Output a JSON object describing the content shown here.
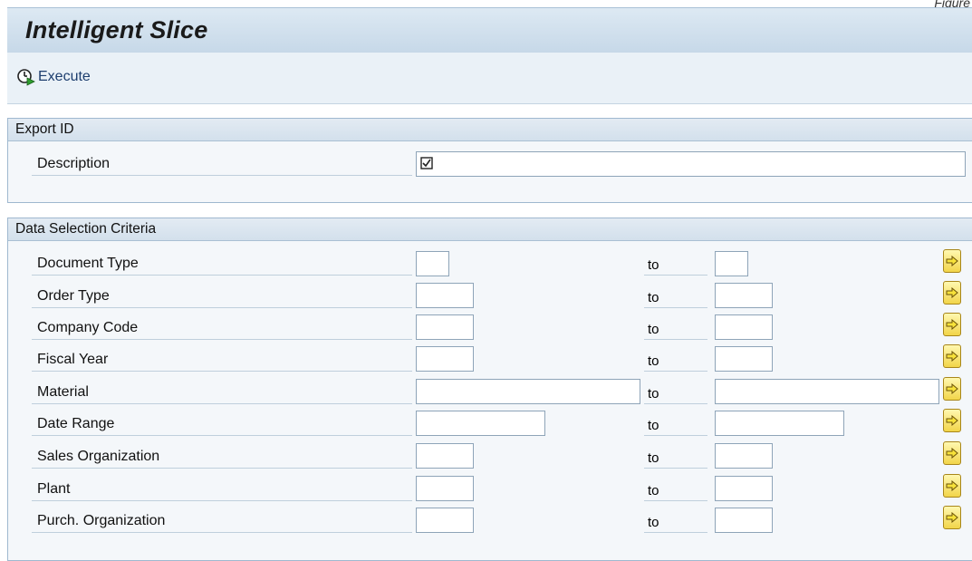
{
  "corner_label": "Figure",
  "title": "Intelligent Slice",
  "toolbar": {
    "execute_label": "Execute",
    "execute_icon": "execute-clock-icon"
  },
  "export_group": {
    "title": "Export ID",
    "row": {
      "label": "Description",
      "checkbox_checked": true,
      "value": ""
    }
  },
  "selection_group": {
    "title": "Data Selection Criteria",
    "to_label": "to",
    "rows": [
      {
        "label": "Document Type",
        "from": "",
        "to": ""
      },
      {
        "label": "Order Type",
        "from": "",
        "to": ""
      },
      {
        "label": "Company Code",
        "from": "",
        "to": ""
      },
      {
        "label": "Fiscal Year",
        "from": "",
        "to": ""
      },
      {
        "label": "Material",
        "from": "",
        "to": ""
      },
      {
        "label": "Date Range",
        "from": "",
        "to": ""
      },
      {
        "label": "Sales Organization",
        "from": "",
        "to": ""
      },
      {
        "label": "Plant",
        "from": "",
        "to": ""
      },
      {
        "label": "Purch. Organization",
        "from": "",
        "to": ""
      }
    ]
  },
  "colors": {
    "title_bar": "#c6d8e8",
    "group_header": "#d3e0ec",
    "more_button": "#f2d54a",
    "execute_text": "#1d3e6e"
  }
}
